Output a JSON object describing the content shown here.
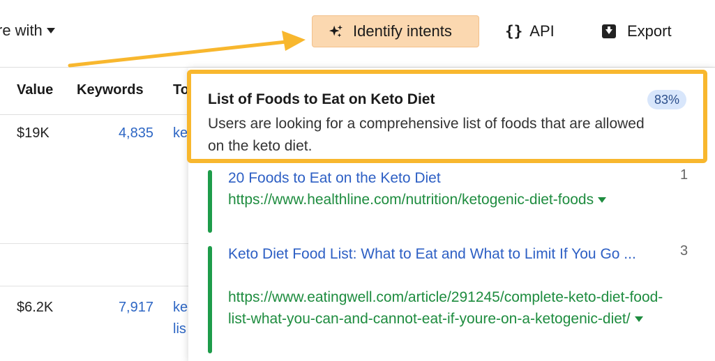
{
  "toolbar": {
    "compare_label": "re with",
    "identify_label": "Identify intents",
    "api_label": "API",
    "export_label": "Export",
    "accent_color": "#fbd8b0",
    "arrow_color": "#f8b72e"
  },
  "table": {
    "headers": {
      "value": "Value",
      "keywords": "Keywords",
      "top": "To"
    },
    "rows": [
      {
        "value": "$19K",
        "keywords": "4,835",
        "top_line1": "ke",
        "top_line2": ""
      },
      {
        "value": "$6.2K",
        "keywords": "7,917",
        "top_line1": "ke",
        "top_line2": "lis"
      }
    ]
  },
  "intent": {
    "title": "List of Foods to Eat on Keto Diet",
    "description": "Users are looking for a comprehensive list of foods that are allowed on the keto diet.",
    "confidence": "83%",
    "results": [
      {
        "title": "20 Foods to Eat on the Keto Diet",
        "url": "https://www.healthline.com/nutrition/ketogenic-diet-foods",
        "rank": "1"
      },
      {
        "title": "Keto Diet Food List: What to Eat and What to Limit If You Go ...",
        "url": "https://www.eatingwell.com/article/291245/complete-keto-diet-food-list-what-you-can-and-cannot-eat-if-youre-on-a-ketogenic-diet/",
        "rank": "3"
      }
    ]
  }
}
